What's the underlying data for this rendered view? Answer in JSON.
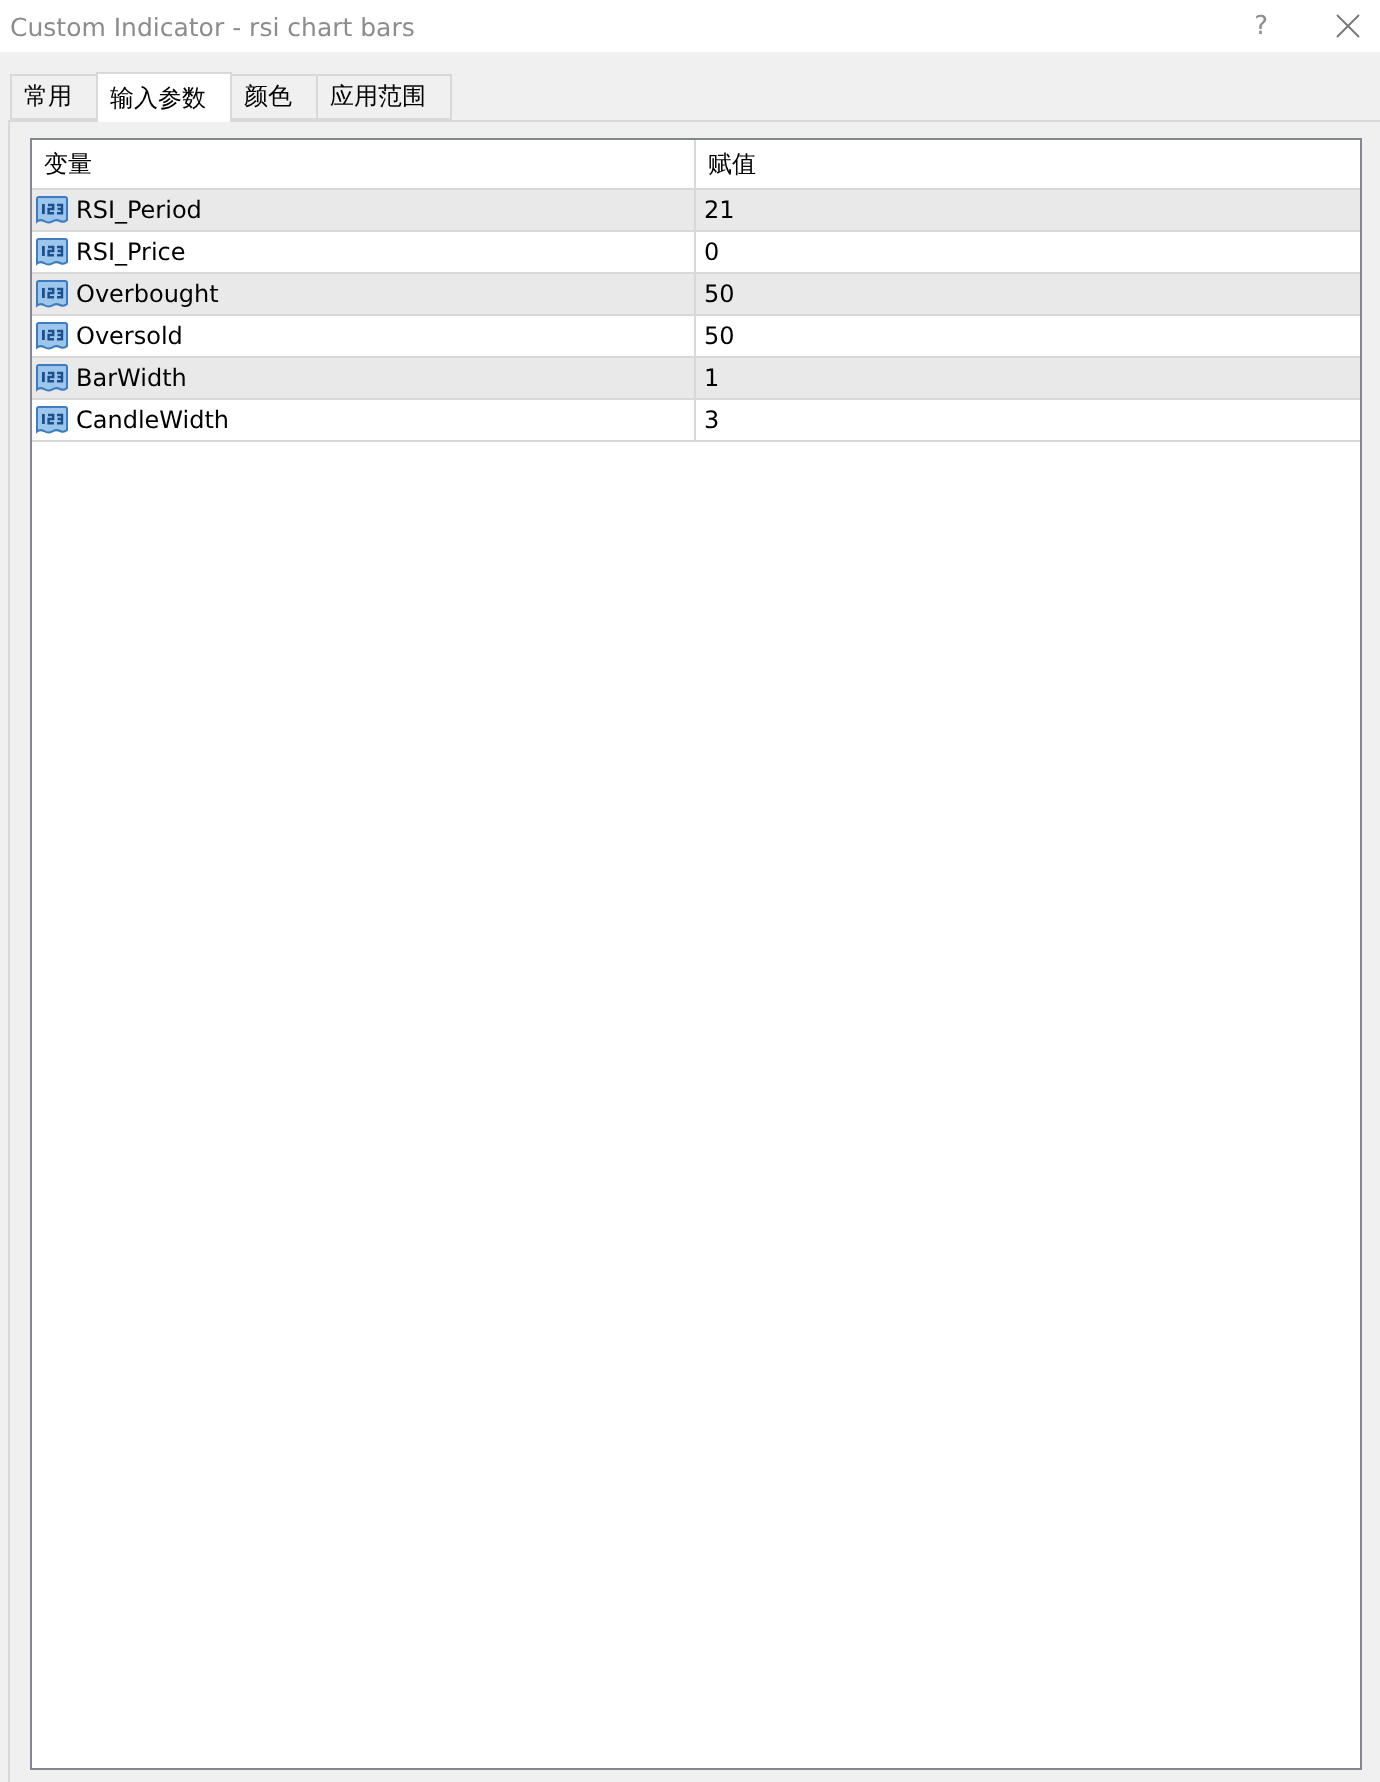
{
  "window": {
    "title": "Custom Indicator - rsi chart bars",
    "help": "?"
  },
  "tabs": [
    {
      "label": "常用",
      "selected": false
    },
    {
      "label": "输入参数",
      "selected": true
    },
    {
      "label": "颜色",
      "selected": false
    },
    {
      "label": "应用范围",
      "selected": false
    }
  ],
  "table": {
    "columns": [
      "变量",
      "赋值"
    ],
    "rows": [
      {
        "name": "RSI_Period",
        "value": "21"
      },
      {
        "name": "RSI_Price",
        "value": "0"
      },
      {
        "name": "Overbought",
        "value": "50"
      },
      {
        "name": "Oversold",
        "value": "50"
      },
      {
        "name": "BarWidth",
        "value": "1"
      },
      {
        "name": "CandleWidth",
        "value": "3"
      }
    ]
  }
}
